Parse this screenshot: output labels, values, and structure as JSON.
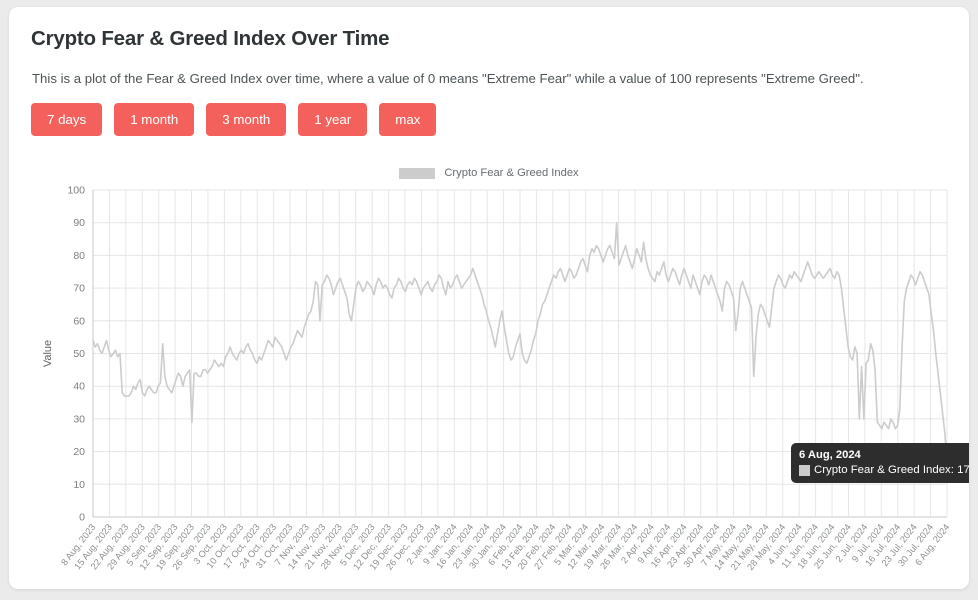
{
  "page": {
    "background": "#ebebeb",
    "card_background": "#ffffff",
    "accent": "#f4615c"
  },
  "header": {
    "title": "Crypto Fear & Greed Index Over Time",
    "subtitle": "This is a plot of the Fear & Greed Index over time, where a value of 0 means \"Extreme Fear\" while a value of 100 represents \"Extreme Greed\"."
  },
  "range_buttons": [
    {
      "label": "7 days"
    },
    {
      "label": "1 month"
    },
    {
      "label": "3 month"
    },
    {
      "label": "1 year"
    },
    {
      "label": "max"
    }
  ],
  "tooltip": {
    "date": "6 Aug, 2024",
    "series_label": "Crypto Fear & Greed Index",
    "value": 17,
    "text": "Crypto Fear & Greed Index: 17",
    "swatch_color": "#cccccc",
    "background": "#2d2d2d"
  },
  "chart_data": {
    "type": "line",
    "title": "",
    "xlabel": "",
    "ylabel": "Value",
    "ylim": [
      0,
      100
    ],
    "yticks": [
      0,
      10,
      20,
      30,
      40,
      50,
      60,
      70,
      80,
      90,
      100
    ],
    "grid": true,
    "legend_position": "top-center",
    "series_color": "#cccccc",
    "legend": [
      "Crypto Fear & Greed Index"
    ],
    "xtick_labels": [
      "8 Aug, 2023",
      "15 Aug, 2023",
      "22 Aug, 2023",
      "29 Aug, 2023",
      "5 Sep, 2023",
      "12 Sep, 2023",
      "19 Sep, 2023",
      "26 Sep, 2023",
      "3 Oct, 2023",
      "10 Oct, 2023",
      "17 Oct, 2023",
      "24 Oct, 2023",
      "31 Oct, 2023",
      "7 Nov, 2023",
      "14 Nov, 2023",
      "21 Nov, 2023",
      "28 Nov, 2023",
      "5 Dec, 2023",
      "12 Dec, 2023",
      "19 Dec, 2023",
      "26 Dec, 2023",
      "2 Jan, 2024",
      "9 Jan, 2024",
      "16 Jan, 2024",
      "23 Jan, 2024",
      "30 Jan, 2024",
      "6 Feb, 2024",
      "13 Feb, 2024",
      "20 Feb, 2024",
      "27 Feb, 2024",
      "5 Mar, 2024",
      "12 Mar, 2024",
      "19 Mar, 2024",
      "26 Mar, 2024",
      "2 Apr, 2024",
      "9 Apr, 2024",
      "16 Apr, 2024",
      "23 Apr, 2024",
      "30 Apr, 2024",
      "7 May, 2024",
      "14 May, 2024",
      "21 May, 2024",
      "28 May, 2024",
      "4 Jun, 2024",
      "11 Jun, 2024",
      "18 Jun, 2024",
      "25 Jun, 2024",
      "2 Jul, 2024",
      "9 Jul, 2024",
      "16 Jul, 2024",
      "23 Jul, 2024",
      "30 Jul, 2024",
      "6 Aug, 2024"
    ],
    "series": [
      {
        "name": "Crypto Fear & Greed Index",
        "values": [
          54,
          52,
          53,
          51,
          50,
          52,
          54,
          51,
          49,
          50,
          51,
          49,
          50,
          38,
          37,
          37,
          37,
          38,
          40,
          39,
          41,
          42,
          38,
          37,
          39,
          40,
          39,
          38,
          38,
          40,
          41,
          53,
          43,
          40,
          39,
          38,
          40,
          42,
          44,
          43,
          40,
          43,
          44,
          45,
          29,
          44,
          44,
          43,
          43,
          45,
          45,
          44,
          45,
          46,
          48,
          47,
          46,
          47,
          46,
          49,
          50,
          52,
          50,
          49,
          48,
          50,
          51,
          50,
          52,
          53,
          51,
          50,
          48,
          47,
          49,
          48,
          50,
          52,
          54,
          53,
          52,
          55,
          54,
          53,
          52,
          50,
          48,
          50,
          52,
          53,
          55,
          57,
          56,
          55,
          58,
          60,
          62,
          63,
          66,
          72,
          71,
          60,
          71,
          72,
          74,
          73,
          71,
          68,
          70,
          72,
          73,
          71,
          69,
          67,
          62,
          60,
          65,
          70,
          72,
          71,
          69,
          70,
          72,
          71,
          70,
          68,
          71,
          73,
          72,
          70,
          71,
          70,
          68,
          67,
          70,
          71,
          73,
          72,
          70,
          69,
          71,
          72,
          71,
          73,
          72,
          70,
          68,
          70,
          71,
          72,
          70,
          69,
          71,
          72,
          74,
          73,
          70,
          68,
          72,
          70,
          71,
          73,
          74,
          72,
          70,
          71,
          72,
          73,
          74,
          76,
          74,
          72,
          70,
          68,
          65,
          63,
          60,
          58,
          55,
          52,
          56,
          60,
          63,
          58,
          54,
          50,
          48,
          49,
          52,
          54,
          56,
          50,
          48,
          47,
          49,
          51,
          54,
          56,
          60,
          62,
          65,
          66,
          68,
          70,
          72,
          74,
          73,
          75,
          76,
          74,
          72,
          74,
          76,
          75,
          73,
          74,
          76,
          78,
          79,
          77,
          75,
          80,
          82,
          81,
          83,
          82,
          80,
          78,
          80,
          82,
          83,
          81,
          79,
          90,
          77,
          79,
          81,
          83,
          80,
          78,
          76,
          79,
          82,
          80,
          78,
          84,
          79,
          76,
          74,
          73,
          72,
          75,
          74,
          76,
          78,
          74,
          72,
          74,
          76,
          75,
          73,
          71,
          74,
          76,
          74,
          72,
          70,
          74,
          72,
          70,
          68,
          72,
          74,
          73,
          71,
          74,
          72,
          70,
          68,
          66,
          63,
          70,
          72,
          71,
          69,
          67,
          57,
          62,
          70,
          72,
          70,
          68,
          66,
          64,
          43,
          55,
          62,
          65,
          64,
          62,
          60,
          58,
          64,
          70,
          72,
          74,
          73,
          71,
          70,
          72,
          74,
          73,
          75,
          74,
          73,
          72,
          74,
          76,
          78,
          76,
          74,
          73,
          74,
          75,
          74,
          73,
          74,
          75,
          76,
          74,
          73,
          75,
          74,
          70,
          64,
          58,
          52,
          49,
          48,
          52,
          50,
          30,
          46,
          30,
          47,
          48,
          53,
          51,
          45,
          29,
          28,
          27,
          29,
          28,
          27,
          30,
          29,
          27,
          28,
          33,
          52,
          66,
          70,
          72,
          74,
          73,
          71,
          73,
          75,
          74,
          72,
          70,
          68,
          62,
          57,
          50,
          44,
          38,
          32,
          26,
          17
        ]
      }
    ]
  },
  "axis": {
    "y_title": "Value"
  }
}
